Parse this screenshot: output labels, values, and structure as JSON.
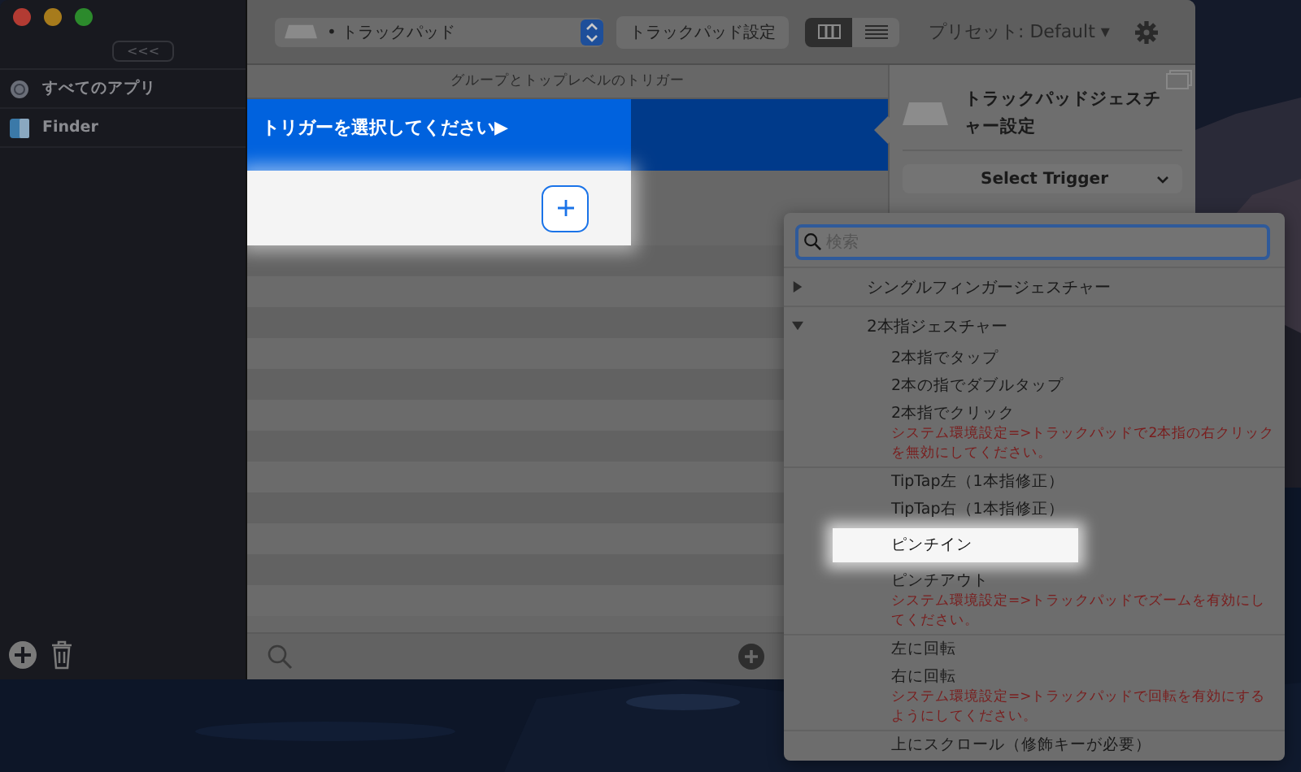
{
  "sidebar": {
    "collapse_button": "<<<",
    "items": [
      {
        "label": "すべてのアプリ",
        "kind": "globe"
      },
      {
        "label": "Finder",
        "kind": "finder"
      }
    ]
  },
  "toolbar": {
    "device_dropdown": "• トラックパッド",
    "settings_button": "トラックパッド設定",
    "view_modes": [
      {
        "kind": "columns",
        "selected": true
      },
      {
        "kind": "list",
        "selected": false
      }
    ],
    "preset": "プリセット: Default ▾"
  },
  "trigger_list": {
    "header": "グループとトップレベルのトリガー",
    "rows": [
      {
        "label": "トリガーを選択してください▶",
        "selected": true
      }
    ]
  },
  "panel": {
    "title": "トラックパッドジェスチャー設定",
    "select_button": "Select Trigger"
  },
  "dropdown": {
    "search_placeholder": "検索",
    "groups": [
      {
        "label": "シングルフィンガージェスチャー",
        "expanded": false
      },
      {
        "label": "2本指ジェスチャー",
        "expanded": true,
        "children": [
          {
            "label": "2本指でタップ",
            "highlighted": false
          },
          {
            "label": "2本の指でダブルタップ",
            "highlighted": false
          },
          {
            "label": "2本指でクリック",
            "note": "システム環境設定=>トラックパッドで2本指の右クリックを無効にしてください。",
            "highlighted": false
          },
          {
            "label": "TipTap左（1本指修正）",
            "highlighted": false
          },
          {
            "label": "TipTap右（1本指修正）",
            "highlighted": false
          },
          {
            "label": "ピンチイン",
            "highlighted": true
          },
          {
            "label": "ピンチアウト",
            "note": "システム環境設定=>トラックパッドでズームを有効にしてください。",
            "highlighted": false
          },
          {
            "label": "左に回転",
            "highlighted": false
          },
          {
            "label": "右に回転",
            "note": "システム環境設定=>トラックパッドで回転を有効にするようにしてください。",
            "highlighted": false
          },
          {
            "label": "上にスクロール（修飾キーが必要）",
            "highlighted": false
          }
        ]
      }
    ]
  }
}
